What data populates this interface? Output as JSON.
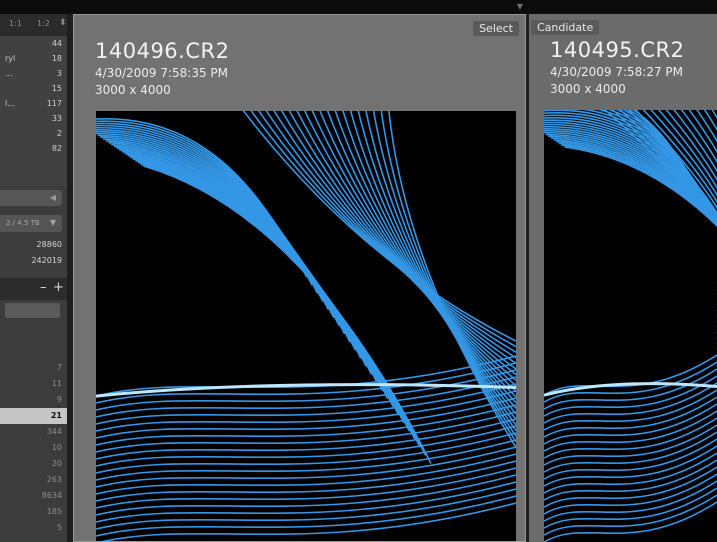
{
  "toolbar": {
    "zoom_options": [
      "1:1",
      "1:2"
    ],
    "stepper_glyph": "⬍"
  },
  "folders": [
    {
      "name": "",
      "count": "44"
    },
    {
      "name": "ryl",
      "count": "18"
    },
    {
      "name": "...",
      "count": "3"
    },
    {
      "name": "",
      "count": "15"
    },
    {
      "name": "l...",
      "count": "117"
    },
    {
      "name": "",
      "count": "33"
    },
    {
      "name": "",
      "count": "2"
    },
    {
      "name": "",
      "count": "82"
    }
  ],
  "drive": {
    "label": "2 / 4.5 TB"
  },
  "stats": [
    "28860",
    "242019"
  ],
  "collections": {
    "minus": "–",
    "plus": "+",
    "counts": [
      "7",
      "11",
      "9",
      "21",
      "344",
      "10",
      "20",
      "263",
      "8634",
      "185",
      "5"
    ],
    "selected_index": 3
  },
  "compare": {
    "select": {
      "tag": "Select",
      "filename": "140496.CR2",
      "date": "4/30/2009 7:58:35 PM",
      "dimensions": "3000 x 4000"
    },
    "candidate": {
      "tag": "Candidate",
      "filename": "140495.CR2",
      "date": "4/30/2009 7:58:27 PM",
      "dimensions": "3000 x 4000"
    }
  },
  "icons": {
    "nav_arrow": "left-triangle-icon",
    "drive_caret": "dropdown-caret-icon",
    "top_arrow": "panel-toggle-arrow-icon"
  },
  "colors": {
    "light_trail": "#3aa8ff",
    "selected_row": "#c6c6c6"
  }
}
